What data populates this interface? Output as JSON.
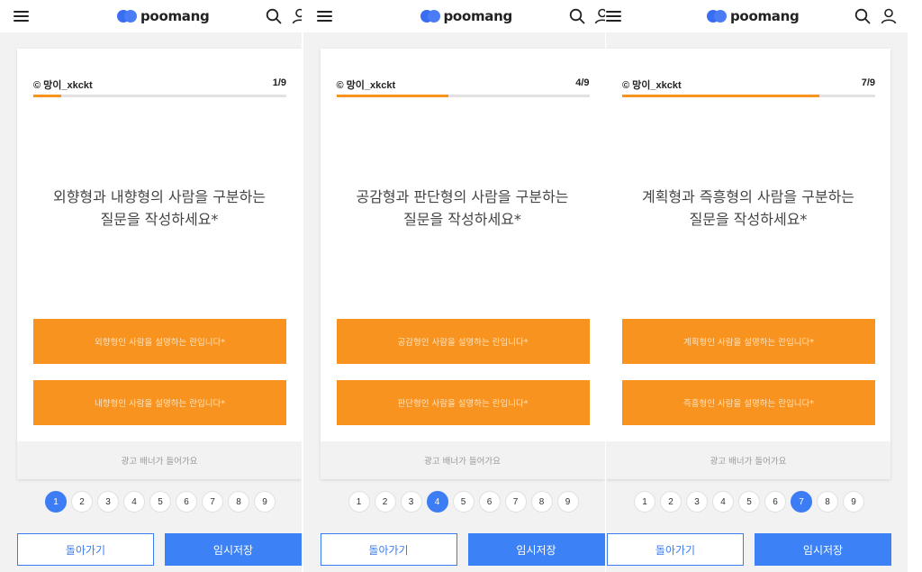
{
  "app": {
    "brand": "poomang",
    "brand_color": "#3a6ef2",
    "accent_color": "#f7931e",
    "primary_color": "#3c82f6"
  },
  "icons": {
    "menu": "hamburger-menu-icon",
    "search": "search-icon",
    "user": "user-icon",
    "logo": "poomang-logo-icon"
  },
  "panels": [
    {
      "author": "© 망이_xkckt",
      "progress_label": "1/9",
      "progress_value": 0.111,
      "question_line1": "외향형과 내향형의 사람을 구분하는",
      "question_line2": "질문을 작성하세요*",
      "answer1_placeholder": "외향형인 사람을 설명하는 란입니다*",
      "answer2_placeholder": "내향형인 사람을 설명하는 란입니다*",
      "ad_text": "광고 배너가 들어가요",
      "active_page": 1,
      "back_label": "돌아가기",
      "save_label": "임시저장"
    },
    {
      "author": "© 망이_xkckt",
      "progress_label": "4/9",
      "progress_value": 0.444,
      "question_line1": "공감형과 판단형의 사람을 구분하는",
      "question_line2": "질문을 작성하세요*",
      "answer1_placeholder": "공감형인 사람을 설명하는 란입니다*",
      "answer2_placeholder": "판단형인 사람을 설명하는 란입니다*",
      "ad_text": "광고 배너가 들어가요",
      "active_page": 4,
      "back_label": "돌아가기",
      "save_label": "임시저장"
    },
    {
      "author": "© 망이_xkckt",
      "progress_label": "7/9",
      "progress_value": 0.778,
      "question_line1": "계획형과 즉흥형의 사람을 구분하는",
      "question_line2": "질문을 작성하세요*",
      "answer1_placeholder": "계획형인 사람을 설명하는 란입니다*",
      "answer2_placeholder": "즉흥형인 사람을 설명하는 란입니다*",
      "ad_text": "광고 배너가 들어가요",
      "active_page": 7,
      "back_label": "돌아가기",
      "save_label": "임시저장"
    }
  ],
  "pages": [
    "1",
    "2",
    "3",
    "4",
    "5",
    "6",
    "7",
    "8",
    "9"
  ]
}
